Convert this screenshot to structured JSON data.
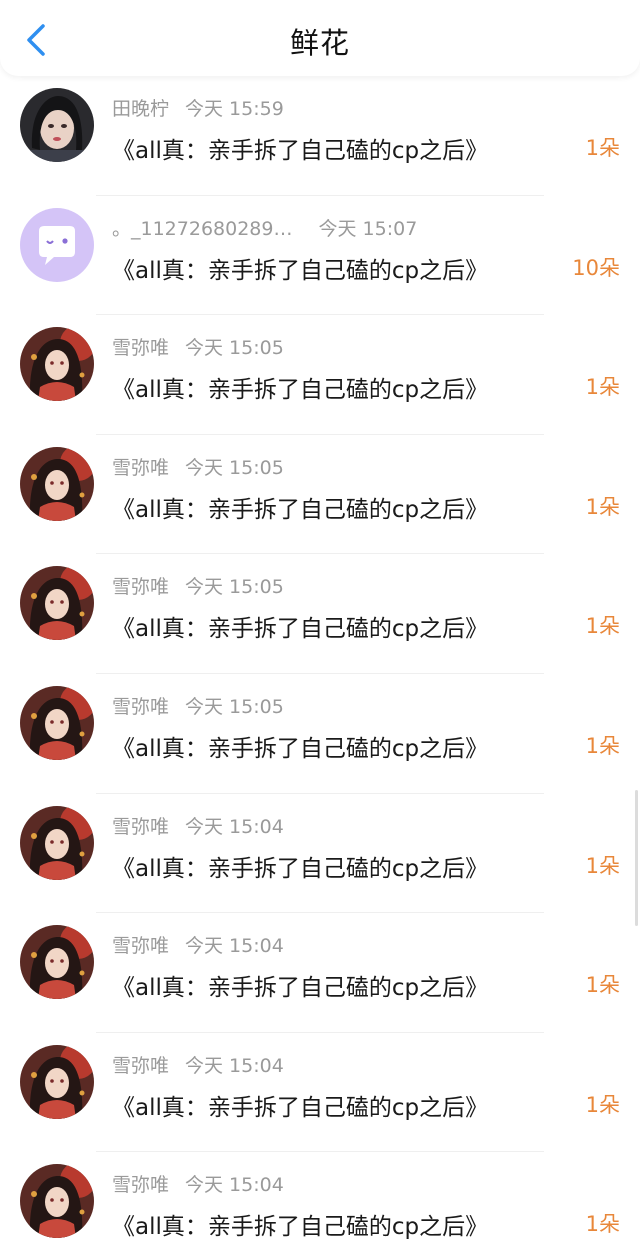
{
  "header": {
    "title": "鲜花",
    "back_icon": "chevron-left-icon",
    "accent": "#2f8ff0"
  },
  "colors": {
    "count": "#e8873a",
    "meta": "#9a9a9a",
    "text": "#1a1a1a"
  },
  "rows": [
    {
      "user": "田晚柠",
      "time": "今天 15:59",
      "work": "《all真：亲手拆了自己磕的cp之后》",
      "count": "1朵",
      "avatar": "photo-avatar"
    },
    {
      "user": "。_11272680289…",
      "time": "今天 15:07",
      "work": "《all真：亲手拆了自己磕的cp之后》",
      "count": "10朵",
      "avatar": "default-chat-avatar"
    },
    {
      "user": "雪弥唯",
      "time": "今天 15:05",
      "work": "《all真：亲手拆了自己磕的cp之后》",
      "count": "1朵",
      "avatar": "anime-avatar"
    },
    {
      "user": "雪弥唯",
      "time": "今天 15:05",
      "work": "《all真：亲手拆了自己磕的cp之后》",
      "count": "1朵",
      "avatar": "anime-avatar"
    },
    {
      "user": "雪弥唯",
      "time": "今天 15:05",
      "work": "《all真：亲手拆了自己磕的cp之后》",
      "count": "1朵",
      "avatar": "anime-avatar"
    },
    {
      "user": "雪弥唯",
      "time": "今天 15:05",
      "work": "《all真：亲手拆了自己磕的cp之后》",
      "count": "1朵",
      "avatar": "anime-avatar"
    },
    {
      "user": "雪弥唯",
      "time": "今天 15:04",
      "work": "《all真：亲手拆了自己磕的cp之后》",
      "count": "1朵",
      "avatar": "anime-avatar"
    },
    {
      "user": "雪弥唯",
      "time": "今天 15:04",
      "work": "《all真：亲手拆了自己磕的cp之后》",
      "count": "1朵",
      "avatar": "anime-avatar"
    },
    {
      "user": "雪弥唯",
      "time": "今天 15:04",
      "work": "《all真：亲手拆了自己磕的cp之后》",
      "count": "1朵",
      "avatar": "anime-avatar"
    },
    {
      "user": "雪弥唯",
      "time": "今天 15:04",
      "work": "《all真：亲手拆了自己磕的cp之后》",
      "count": "1朵",
      "avatar": "anime-avatar"
    }
  ]
}
